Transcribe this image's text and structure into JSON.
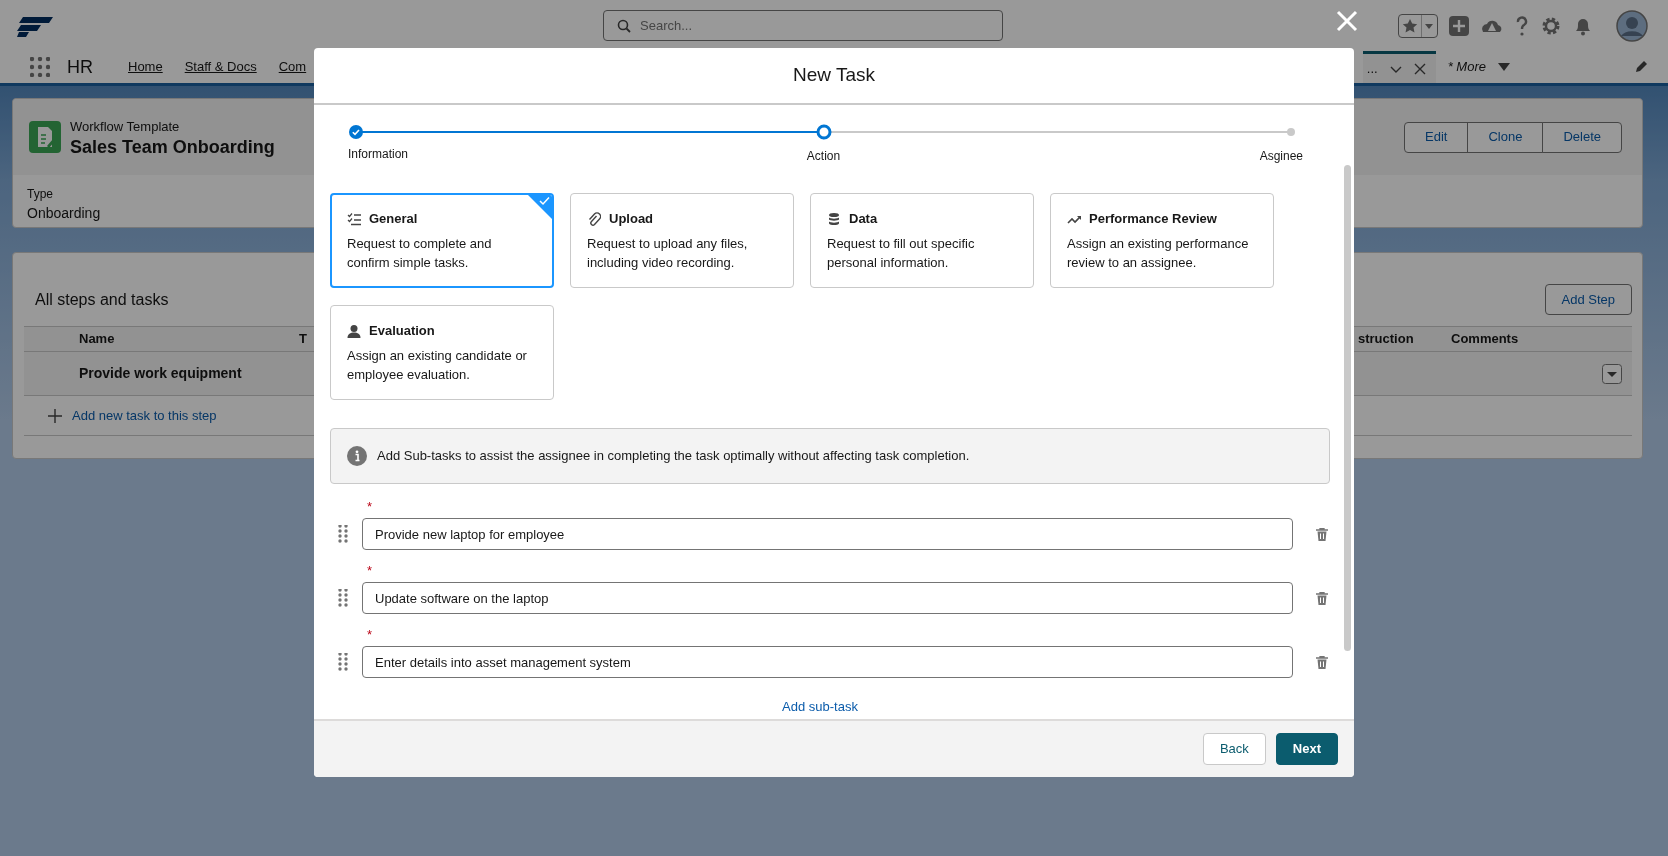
{
  "app": {
    "search": {
      "placeholder": "Search..."
    },
    "app_name": "HR",
    "nav_items": [
      {
        "label": "Home"
      },
      {
        "label": "Staff & Docs"
      },
      {
        "label": "Com"
      }
    ],
    "open_tab": {
      "label": "..."
    },
    "more": {
      "label": "* More"
    }
  },
  "record": {
    "object_type": "Workflow Template",
    "title": "Sales Team Onboarding",
    "actions": [
      "Edit",
      "Clone",
      "Delete"
    ],
    "fields": [
      {
        "label": "Type",
        "value": "Onboarding"
      }
    ]
  },
  "steps": {
    "title": "All steps and tasks",
    "add_button": "Add Step",
    "columns": [
      "Name",
      "T",
      "struction",
      "Comments"
    ],
    "rows": [
      {
        "name": "Provide work equipment"
      }
    ],
    "add_task": "Add new task to this step"
  },
  "modal": {
    "title": "New Task",
    "steps": [
      {
        "label": "Information",
        "done": true,
        "selected": false
      },
      {
        "label": "Action",
        "done": false,
        "selected": true
      },
      {
        "label": "Asginee",
        "done": false,
        "selected": false
      }
    ],
    "task_types": [
      {
        "kind": "general",
        "title": "General",
        "description": "Request to complete and confirm simple tasks.",
        "selected": true
      },
      {
        "kind": "upload",
        "title": "Upload",
        "description": "Request to upload any files, including video recording.",
        "selected": false
      },
      {
        "kind": "data",
        "title": "Data",
        "description": "Request to fill out specific personal information.",
        "selected": false
      },
      {
        "kind": "performance",
        "title": "Performance Review",
        "description": "Assign an existing performance review to an assignee.",
        "selected": false
      },
      {
        "kind": "evaluation",
        "title": "Evaluation",
        "description": "Assign an existing candidate or employee evaluation.",
        "selected": false
      }
    ],
    "info": "Add Sub-tasks to assist the assignee in completing the task optimally without affecting task completion.",
    "subtasks": [
      {
        "required_mark": "*",
        "value": "Provide new laptop for employee"
      },
      {
        "required_mark": "*",
        "value": "Update software on the laptop"
      },
      {
        "required_mark": "*",
        "value": "Enter details into asset management system"
      }
    ],
    "add_subtask": "Add sub-task",
    "buttons": [
      {
        "label": "Back",
        "kind": "neutral"
      },
      {
        "label": "Next",
        "kind": "brand"
      }
    ]
  }
}
